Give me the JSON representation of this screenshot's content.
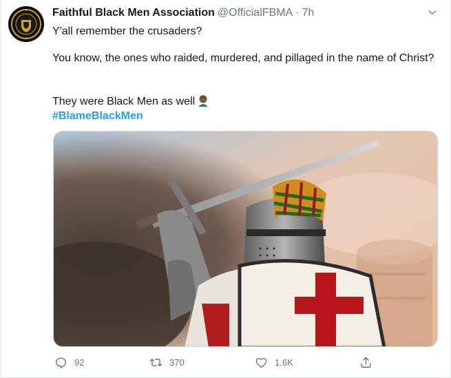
{
  "tweet": {
    "author_name": "Faithful Black Men Association",
    "handle": "@OfficialFBMA",
    "separator": "·",
    "time": "7h",
    "line1": "Y'all remember the crusaders?",
    "line2": "You know, the ones who raided, murdered, and pillaged in the name of Christ?",
    "line3": "They were Black Men as well",
    "hashtag": "#BlameBlackMen",
    "emoji": "person-facepalming-emoji"
  },
  "actions": {
    "replies": "92",
    "retweets": "370",
    "likes": "1.6K"
  },
  "icons": {
    "menu": "chevron-down-icon",
    "reply": "reply-icon",
    "retweet": "retweet-icon",
    "like": "heart-icon",
    "share": "share-icon"
  },
  "colors": {
    "link": "#1da1f2",
    "secondary_text": "#657786",
    "primary_text": "#14171a"
  }
}
